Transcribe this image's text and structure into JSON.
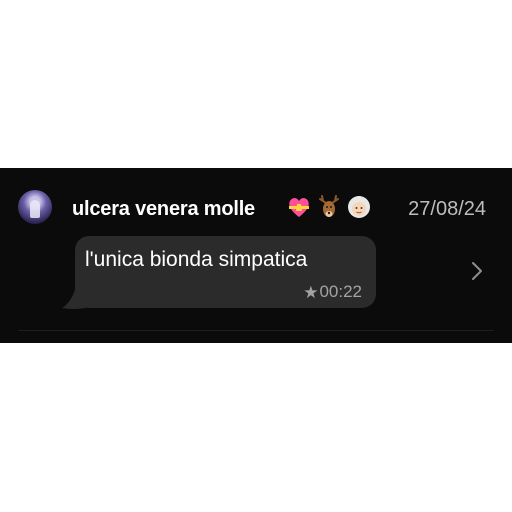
{
  "message": {
    "sender_name": "ulcera venera molle",
    "sender_emojis": [
      "heart-with-ribbon-icon",
      "deer-icon",
      "older-woman-icon"
    ],
    "date": "27/08/24",
    "text": "l'unica bionda simpatica",
    "time": "00:22",
    "starred": true,
    "star_glyph": "★"
  },
  "colors": {
    "background": "#0b0b0b",
    "bubble": "#2b2b2b",
    "text": "#ffffff",
    "meta_text": "#a3a3a3"
  }
}
